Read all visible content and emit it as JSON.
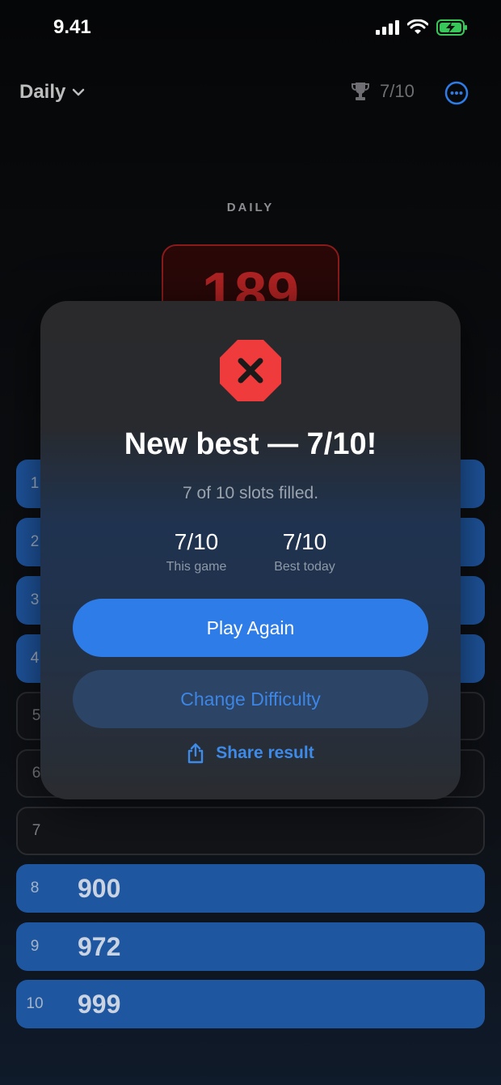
{
  "status_bar": {
    "time": "9.41",
    "icons": [
      "signal-icon",
      "wifi-icon",
      "battery-charging-icon"
    ]
  },
  "header": {
    "mode_label": "Daily",
    "best_score": "7/10",
    "icons": [
      "chevron-down-icon",
      "trophy-icon",
      "more-icon"
    ]
  },
  "game": {
    "mode_caption": "DAILY",
    "target_number": "189",
    "slots": [
      {
        "index": "1",
        "value": "",
        "filled": true
      },
      {
        "index": "2",
        "value": "",
        "filled": true
      },
      {
        "index": "3",
        "value": "",
        "filled": true
      },
      {
        "index": "4",
        "value": "",
        "filled": true
      },
      {
        "index": "5",
        "value": "",
        "filled": false
      },
      {
        "index": "6",
        "value": "",
        "filled": false
      },
      {
        "index": "7",
        "value": "",
        "filled": false
      },
      {
        "index": "8",
        "value": "900",
        "filled": true
      },
      {
        "index": "9",
        "value": "972",
        "filled": true
      },
      {
        "index": "10",
        "value": "999",
        "filled": true
      }
    ]
  },
  "modal": {
    "icon": "close-octagon-icon",
    "title": "New best — 7/10!",
    "subtitle": "7 of 10 slots filled.",
    "stats": [
      {
        "value": "7/10",
        "label": "This game"
      },
      {
        "value": "7/10",
        "label": "Best today"
      }
    ],
    "primary_button": "Play Again",
    "secondary_button": "Change Difficulty",
    "share_label": "Share result",
    "share_icon": "share-icon"
  },
  "colors": {
    "accent": "#2e7ce8",
    "slot_filled": "#1f56a0",
    "danger": "#ef3b3b",
    "link": "#3d8ae8"
  }
}
